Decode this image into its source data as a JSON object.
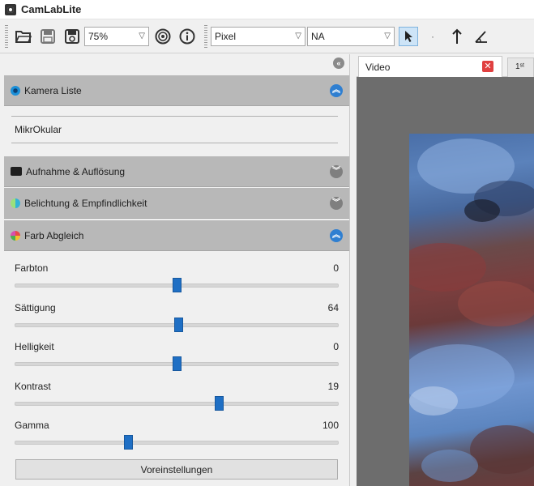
{
  "app": {
    "title": "CamLabLite"
  },
  "toolbar": {
    "zoom": "75%",
    "unit": "Pixel",
    "objective": "NA",
    "tick_glyph": "·"
  },
  "panel": {
    "collapse_glyph": "«",
    "sections": {
      "camera_list": {
        "label": "Kamera Liste",
        "expanded": true,
        "icon": "camera-lens-icon",
        "color": "#1a8fd8"
      },
      "capture": {
        "label": "Aufnahme & Auflösung",
        "expanded": false,
        "icon": "camera-icon"
      },
      "exposure": {
        "label": "Belichtung & Empfindlichkeit",
        "expanded": false,
        "icon": "exposure-icon",
        "color": "#33b3d6"
      },
      "color_balance": {
        "label": "Farb Abgleich",
        "expanded": true,
        "icon": "color-wheel-icon",
        "color": "#d84fae"
      }
    },
    "camera_name": "MikrOkular",
    "sliders": [
      {
        "label": "Farbton",
        "value": "0",
        "fraction": 0.5
      },
      {
        "label": "Sättigung",
        "value": "64",
        "fraction": 0.505
      },
      {
        "label": "Helligkeit",
        "value": "0",
        "fraction": 0.5
      },
      {
        "label": "Kontrast",
        "value": "19",
        "fraction": 0.63
      },
      {
        "label": "Gamma",
        "value": "100",
        "fraction": 0.35
      }
    ],
    "preset_button": "Voreinstellungen"
  },
  "tabs": {
    "video_label": "Video",
    "close_glyph": "✕",
    "next_label": "1ˢᵗ"
  },
  "colors": {
    "accent": "#2f7fd1",
    "slider_thumb": "#1f6fc4",
    "header_bg": "#b8b8b8",
    "close_red": "#e04040"
  }
}
